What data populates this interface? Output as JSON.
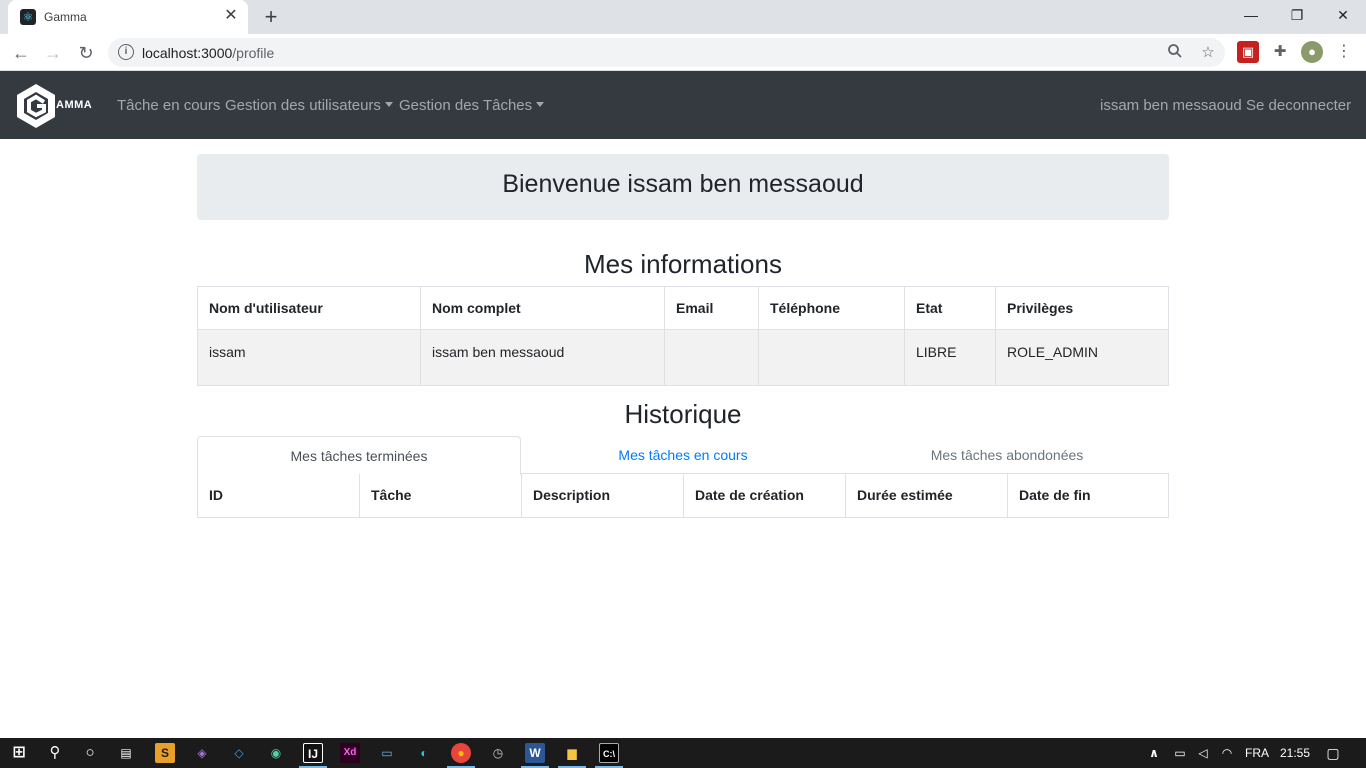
{
  "browser": {
    "tab_title": "Gamma",
    "url_host": "localhost:3000",
    "url_path": "/profile"
  },
  "navbar": {
    "brand_text": "AMMA",
    "links": {
      "current_task": "Tâche en cours",
      "user_management": "Gestion des utilisateurs",
      "task_management": "Gestion des Tâches",
      "user_name": "issam ben messaoud",
      "logout": "Se deconnecter"
    }
  },
  "welcome": "Bienvenue issam ben messaoud",
  "info": {
    "title": "Mes informations",
    "headers": [
      "Nom d'utilisateur",
      "Nom complet",
      "Email",
      "Téléphone",
      "Etat",
      "Privilèges"
    ],
    "row": [
      "issam",
      "issam ben messaoud",
      "",
      "",
      "LIBRE",
      "ROLE_ADMIN"
    ]
  },
  "history": {
    "title": "Historique",
    "tabs": [
      "Mes tâches terminées",
      "Mes tâches en cours",
      "Mes tâches abondonées"
    ],
    "headers": [
      "ID",
      "Tâche",
      "Description",
      "Date de création",
      "Durée estimée",
      "Date de fin"
    ]
  },
  "taskbar": {
    "language": "FRA",
    "time": "21:55"
  },
  "colors": {
    "navbar_bg": "#343a40",
    "link_blue": "#007bff",
    "jumbotron_bg": "#e9ecef"
  }
}
